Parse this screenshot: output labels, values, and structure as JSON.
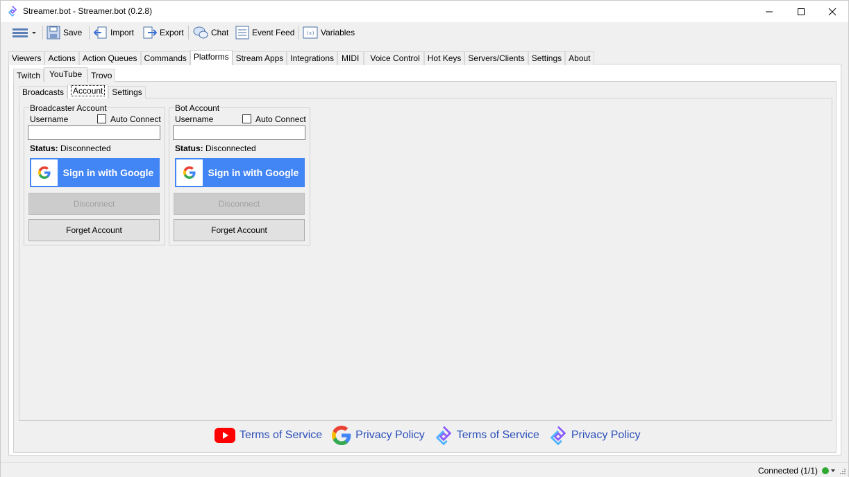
{
  "window": {
    "title": "Streamer.bot - Streamer.bot (0.2.8)",
    "accent": "#4285f4"
  },
  "toolbar": {
    "save": "Save",
    "import": "Import",
    "export": "Export",
    "chat": "Chat",
    "event_feed": "Event Feed",
    "variables": "Variables"
  },
  "main_tabs": [
    "Viewers",
    "Actions",
    "Action Queues",
    "Commands",
    "Platforms",
    "Stream Apps",
    "Integrations",
    "MIDI",
    "Voice Control",
    "Hot Keys",
    "Servers/Clients",
    "Settings",
    "About"
  ],
  "main_tab_active": "Platforms",
  "platform_tabs": [
    "Twitch",
    "YouTube",
    "Trovo"
  ],
  "platform_tab_active": "YouTube",
  "youtube_tabs": [
    "Broadcasts",
    "Account",
    "Settings"
  ],
  "youtube_tab_active": "Account",
  "broadcaster": {
    "legend": "Broadcaster Account",
    "username_label": "Username",
    "auto_connect": "Auto Connect",
    "username_value": "",
    "status_label": "Status:",
    "status_value": "Disconnected",
    "sign_in": "Sign in with Google",
    "disconnect": "Disconnect",
    "forget": "Forget Account"
  },
  "bot": {
    "legend": "Bot Account",
    "username_label": "Username",
    "auto_connect": "Auto Connect",
    "username_value": "",
    "status_label": "Status:",
    "status_value": "Disconnected",
    "sign_in": "Sign in with Google",
    "disconnect": "Disconnect",
    "forget": "Forget Account"
  },
  "footer": {
    "youtube_tos": "Terms of Service",
    "google_privacy": "Privacy Policy",
    "sb_tos": "Terms of Service",
    "sb_privacy": "Privacy Policy"
  },
  "statusbar": {
    "connection": "Connected (1/1)",
    "status_color": "#2fa82f"
  }
}
